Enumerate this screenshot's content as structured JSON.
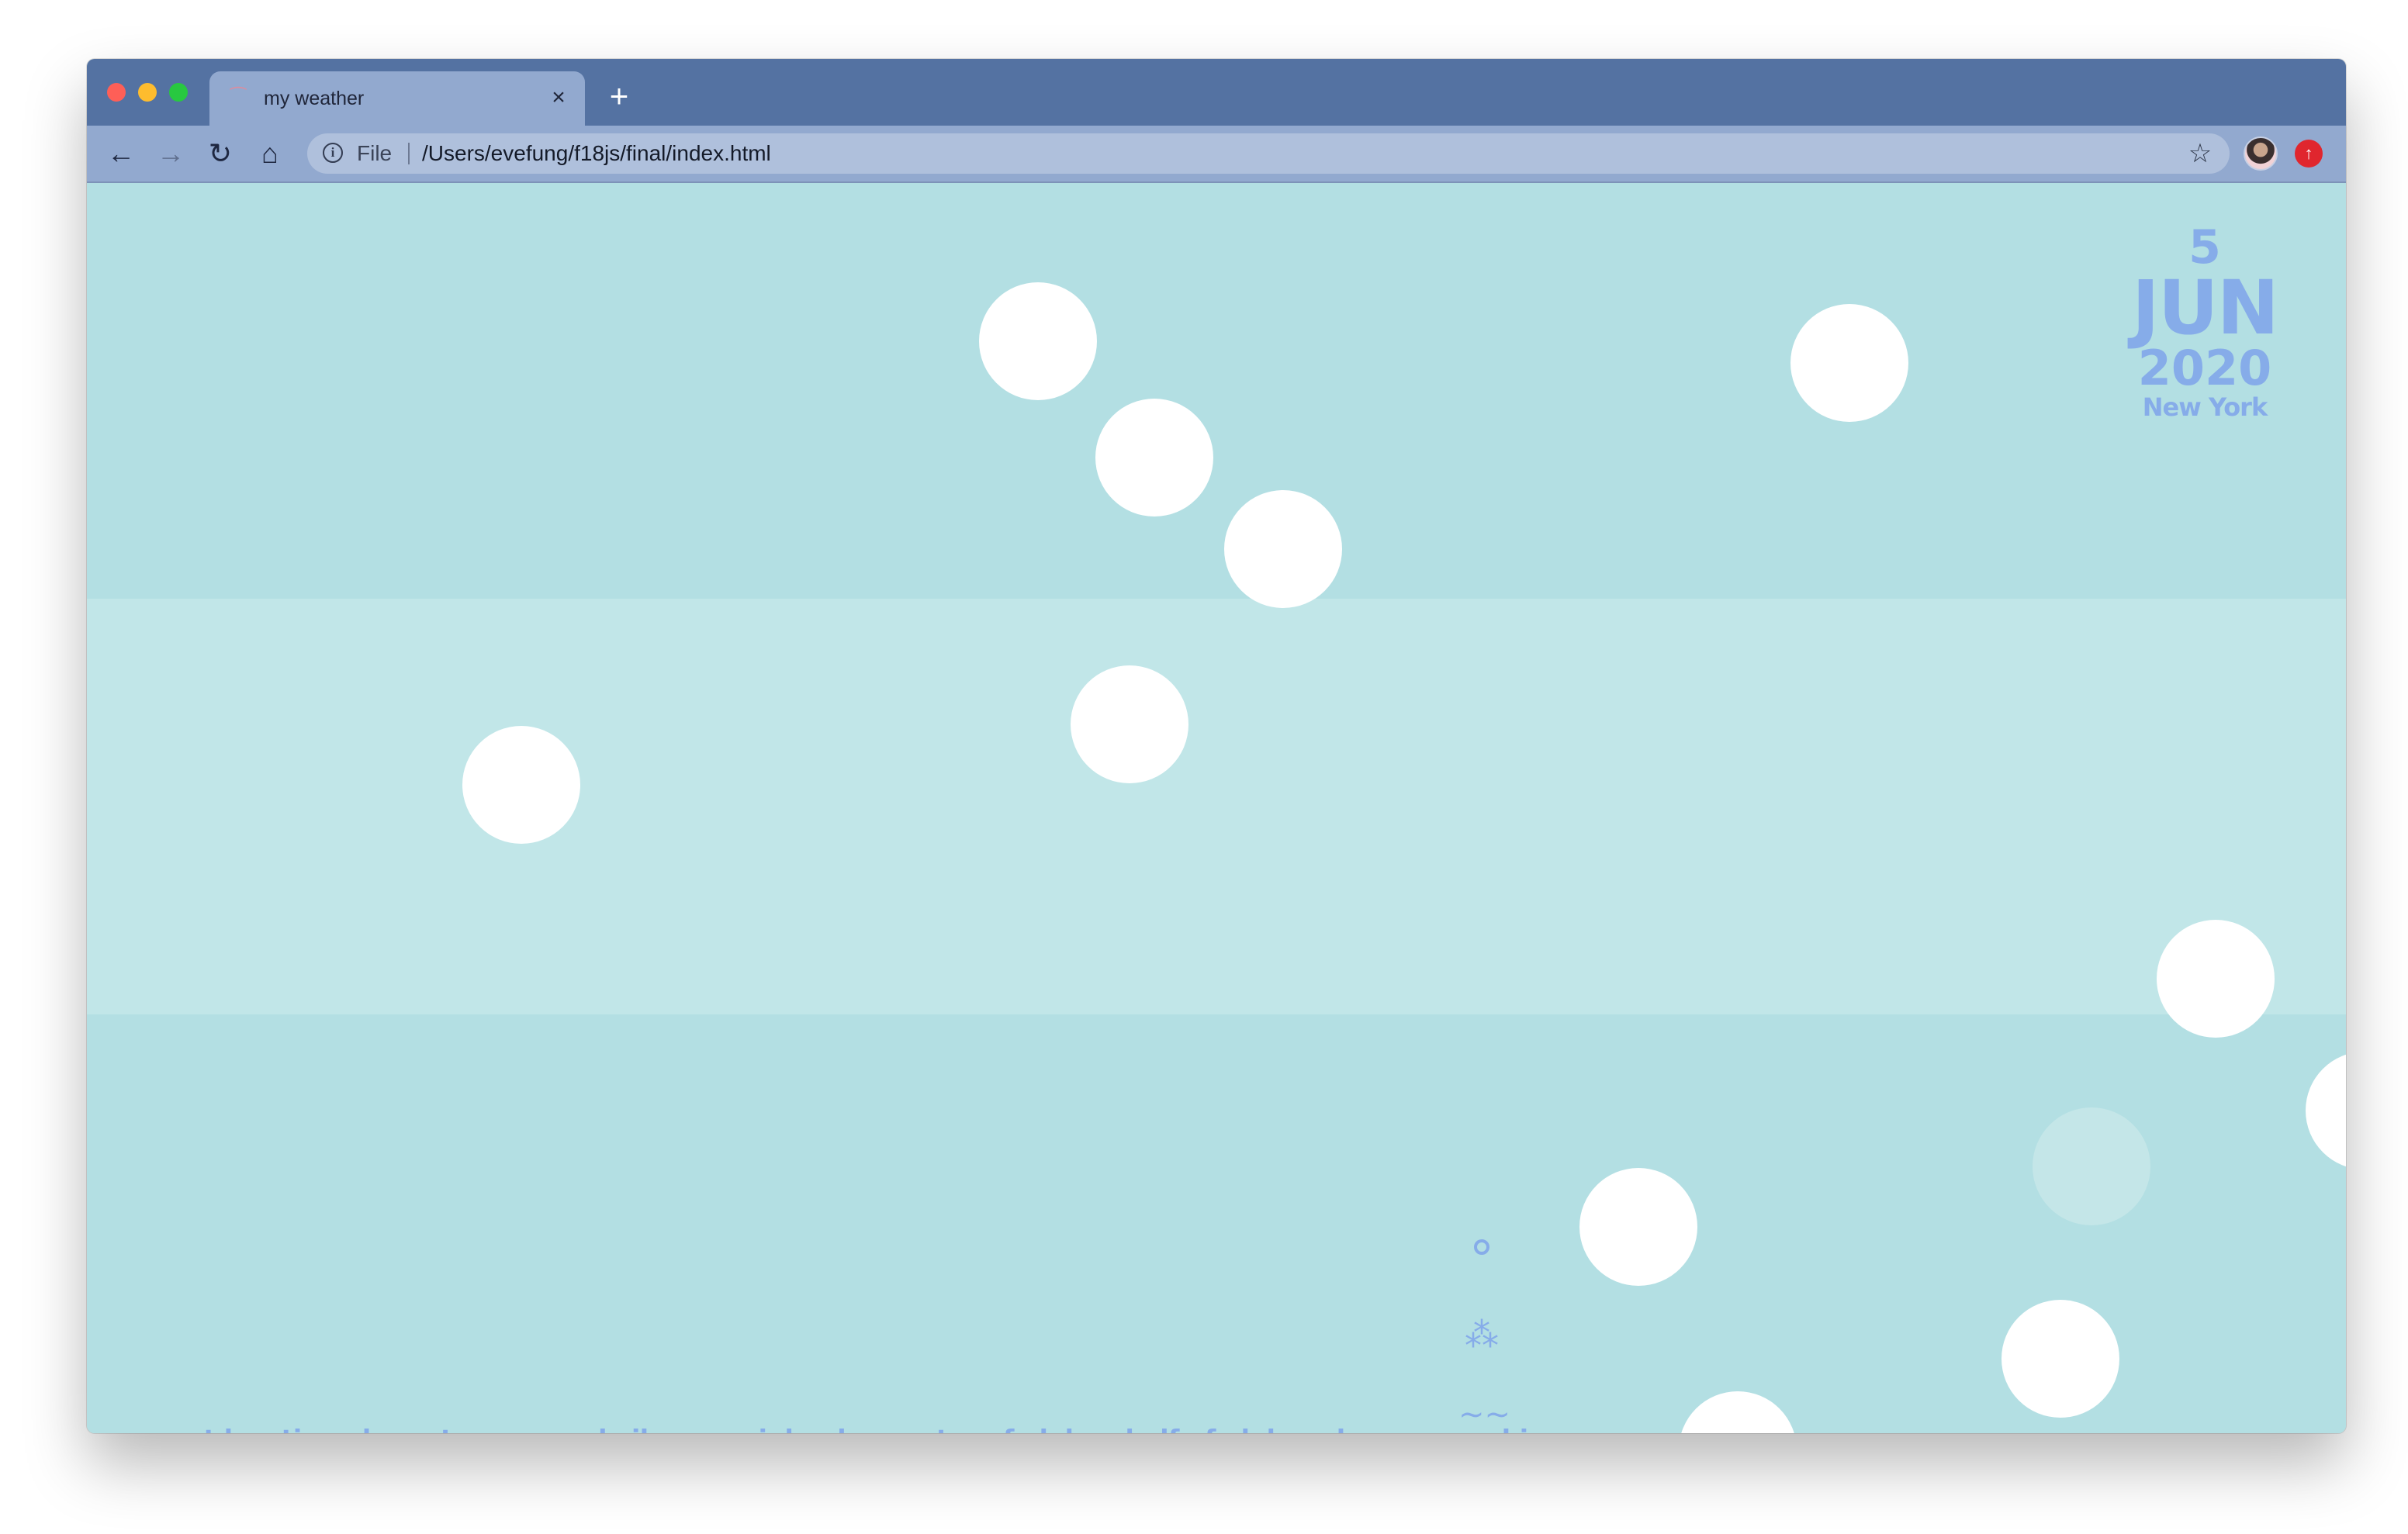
{
  "browser": {
    "tab_title": "my weather",
    "tab_close_glyph": "×",
    "new_tab_glyph": "+",
    "scheme_label": "File",
    "url": "/Users/evefung/f18js/final/index.html",
    "icons": [
      "back-arrow-icon",
      "forward-arrow-icon",
      "reload-icon",
      "home-icon",
      "info-icon",
      "star-icon",
      "profile-avatar",
      "extension-icon"
    ]
  },
  "colors": {
    "titlebar": "#5472a2",
    "toolbar": "#92a9cf",
    "omnibox": "#afc0dc",
    "band_dark": "#b3dfe3",
    "band_light": "#c1e6e8",
    "accent_text": "#86ace9",
    "dot": "#ffffff"
  },
  "date": {
    "day": "5",
    "month": "JUN",
    "year": "2020",
    "city": "New York"
  },
  "weather_icons": [
    "ring-icon",
    "snowflake-icon",
    "wave-icon"
  ],
  "nav": {
    "links": [
      "current location",
      "hometown",
      "good vibes",
      "mainland",
      "quarter of aloha",
      "half of aloha",
      "dreams",
      "archive"
    ]
  }
}
